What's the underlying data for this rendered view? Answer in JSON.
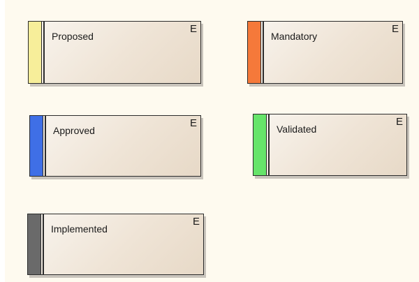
{
  "elements": [
    {
      "name": "Proposed",
      "marker": "E",
      "status_color": "#f7ee9a"
    },
    {
      "name": "Mandatory",
      "marker": "E",
      "status_color": "#f5793a"
    },
    {
      "name": "Approved",
      "marker": "E",
      "status_color": "#3f6fe6"
    },
    {
      "name": "Validated",
      "marker": "E",
      "status_color": "#66e46a"
    },
    {
      "name": "Implemented",
      "marker": "E",
      "status_color": "#6a6a6a"
    }
  ]
}
